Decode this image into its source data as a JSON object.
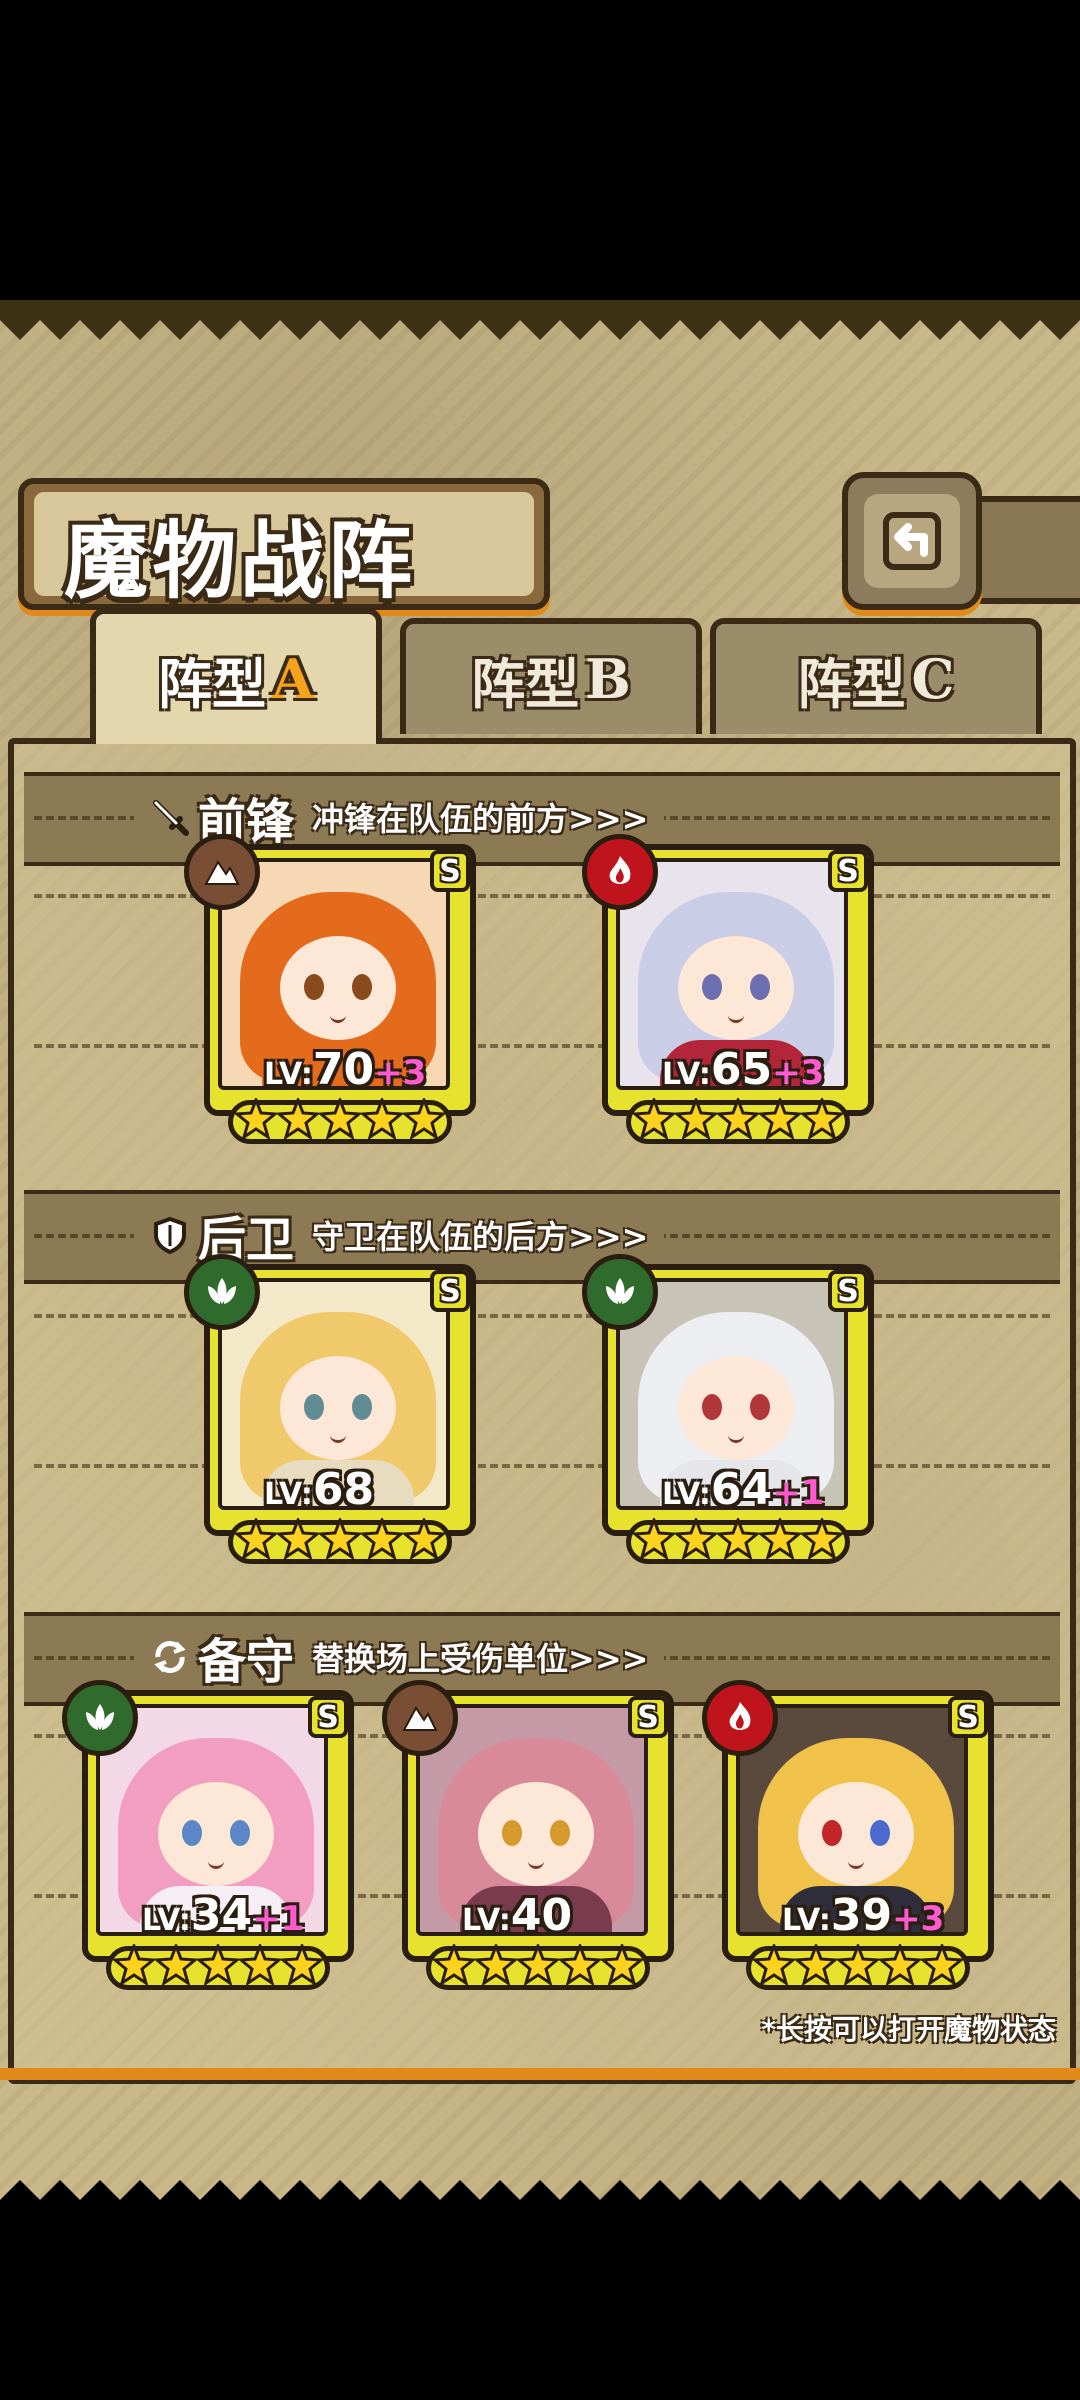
{
  "title": "魔物战阵",
  "back_button": {
    "icon": "back-arrow-icon"
  },
  "tabs": [
    {
      "label": "阵型",
      "letter": "A",
      "active": true
    },
    {
      "label": "阵型",
      "letter": "B",
      "active": false
    },
    {
      "label": "阵型",
      "letter": "C",
      "active": false
    }
  ],
  "sections": {
    "vanguard": {
      "name": "前锋",
      "desc": "冲锋在队伍的前方>>>",
      "icon": "sword-icon"
    },
    "rearguard": {
      "name": "后卫",
      "desc": "守卫在队伍的后方>>>",
      "icon": "shield-icon"
    },
    "reserve": {
      "name": "备守",
      "desc": "替换场上受伤单位>>>",
      "icon": "swap-icon"
    }
  },
  "units": {
    "v1": {
      "lv_prefix": "LV:",
      "level": "70",
      "bonus": "+3",
      "rank": "S",
      "element": "earth",
      "stars": 5
    },
    "v2": {
      "lv_prefix": "LV:",
      "level": "65",
      "bonus": "+3",
      "rank": "S",
      "element": "fire",
      "stars": 5
    },
    "r1": {
      "lv_prefix": "LV:",
      "level": "68",
      "bonus": "",
      "rank": "S",
      "element": "nature",
      "stars": 5
    },
    "r2": {
      "lv_prefix": "LV:",
      "level": "64",
      "bonus": "+1",
      "rank": "S",
      "element": "nature",
      "stars": 5
    },
    "b1": {
      "lv_prefix": "LV:",
      "level": "34",
      "bonus": "+1",
      "rank": "S",
      "element": "nature",
      "stars": 5
    },
    "b2": {
      "lv_prefix": "LV:",
      "level": "40",
      "bonus": "",
      "rank": "S",
      "element": "earth",
      "stars": 5
    },
    "b3": {
      "lv_prefix": "LV:",
      "level": "39",
      "bonus": "+3",
      "rank": "S",
      "element": "fire",
      "stars": 5
    }
  },
  "element_colors": {
    "earth": "#7a4e35",
    "fire": "#c0141c",
    "nature": "#2f6b2c"
  },
  "footnote": "*长按可以打开魔物状态"
}
